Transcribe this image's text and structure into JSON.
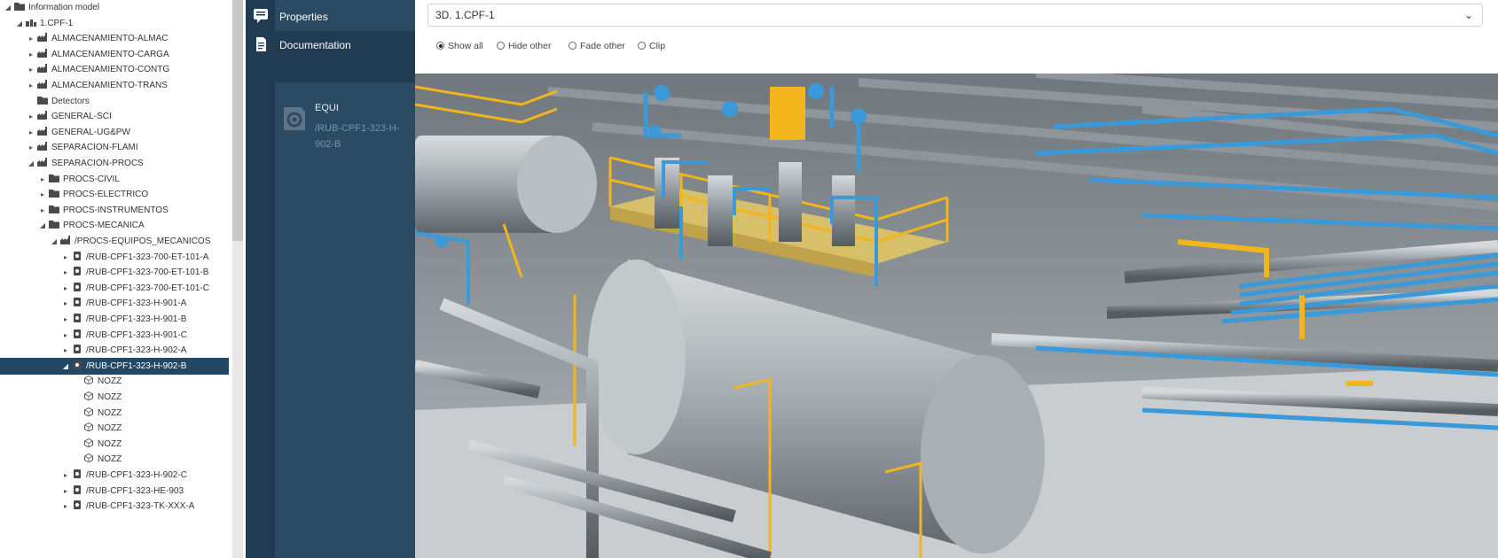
{
  "tree": {
    "items": [
      {
        "label": "Information model",
        "level": 0,
        "toggle": "◢",
        "icon": "folder-icon"
      },
      {
        "label": "1.CPF-1",
        "level": 1,
        "toggle": "◢",
        "icon": "site-icon"
      },
      {
        "label": "ALMACENAMIENTO-ALMAC",
        "level": 2,
        "toggle": "▸",
        "icon": "plant-icon"
      },
      {
        "label": "ALMACENAMIENTO-CARGA",
        "level": 2,
        "toggle": "▸",
        "icon": "plant-icon"
      },
      {
        "label": "ALMACENAMIENTO-CONTG",
        "level": 2,
        "toggle": "▸",
        "icon": "plant-icon"
      },
      {
        "label": "ALMACENAMIENTO-TRANS",
        "level": 2,
        "toggle": "▸",
        "icon": "plant-icon"
      },
      {
        "label": "Detectors",
        "level": 2,
        "toggle": "",
        "icon": "folder-icon"
      },
      {
        "label": "GENERAL-SCI",
        "level": 2,
        "toggle": "▸",
        "icon": "plant-icon"
      },
      {
        "label": "GENERAL-UG&PW",
        "level": 2,
        "toggle": "▸",
        "icon": "plant-icon"
      },
      {
        "label": "SEPARACION-FLAMI",
        "level": 2,
        "toggle": "▸",
        "icon": "plant-icon"
      },
      {
        "label": "SEPARACION-PROCS",
        "level": 2,
        "toggle": "◢",
        "icon": "plant-icon"
      },
      {
        "label": "PROCS-CIVIL",
        "level": 3,
        "toggle": "▸",
        "icon": "folder-icon"
      },
      {
        "label": "PROCS-ELECTRICO",
        "level": 3,
        "toggle": "▸",
        "icon": "folder-icon"
      },
      {
        "label": "PROCS-INSTRUMENTOS",
        "level": 3,
        "toggle": "▸",
        "icon": "folder-icon"
      },
      {
        "label": "PROCS-MECANICA",
        "level": 3,
        "toggle": "◢",
        "icon": "folder-icon"
      },
      {
        "label": "/PROCS-EQUIPOS_MECANICOS",
        "level": 4,
        "toggle": "◢",
        "icon": "plant-icon"
      },
      {
        "label": "/RUB-CPF1-323-700-ET-101-A",
        "level": 5,
        "toggle": "▸",
        "icon": "equipment-icon"
      },
      {
        "label": "/RUB-CPF1-323-700-ET-101-B",
        "level": 5,
        "toggle": "▸",
        "icon": "equipment-icon"
      },
      {
        "label": "/RUB-CPF1-323-700-ET-101-C",
        "level": 5,
        "toggle": "▸",
        "icon": "equipment-icon"
      },
      {
        "label": "/RUB-CPF1-323-H-901-A",
        "level": 5,
        "toggle": "▸",
        "icon": "equipment-icon"
      },
      {
        "label": "/RUB-CPF1-323-H-901-B",
        "level": 5,
        "toggle": "▸",
        "icon": "equipment-icon"
      },
      {
        "label": "/RUB-CPF1-323-H-901-C",
        "level": 5,
        "toggle": "▸",
        "icon": "equipment-icon"
      },
      {
        "label": "/RUB-CPF1-323-H-902-A",
        "level": 5,
        "toggle": "▸",
        "icon": "equipment-icon"
      },
      {
        "label": "/RUB-CPF1-323-H-902-B",
        "level": 5,
        "toggle": "◢",
        "icon": "equipment-icon",
        "selected": true
      },
      {
        "label": "NOZZ",
        "level": 6,
        "toggle": "",
        "icon": "nozzle-icon"
      },
      {
        "label": "NOZZ",
        "level": 6,
        "toggle": "",
        "icon": "nozzle-icon"
      },
      {
        "label": "NOZZ",
        "level": 6,
        "toggle": "",
        "icon": "nozzle-icon"
      },
      {
        "label": "NOZZ",
        "level": 6,
        "toggle": "",
        "icon": "nozzle-icon"
      },
      {
        "label": "NOZZ",
        "level": 6,
        "toggle": "",
        "icon": "nozzle-icon"
      },
      {
        "label": "NOZZ",
        "level": 6,
        "toggle": "",
        "icon": "nozzle-icon"
      },
      {
        "label": "/RUB-CPF1-323-H-902-C",
        "level": 5,
        "toggle": "▸",
        "icon": "equipment-icon"
      },
      {
        "label": "/RUB-CPF1-323-HE-903",
        "level": 5,
        "toggle": "▸",
        "icon": "equipment-icon"
      },
      {
        "label": "/RUB-CPF1-323-TK-XXX-A",
        "level": 5,
        "toggle": "▸",
        "icon": "equipment-icon"
      }
    ]
  },
  "sidenav": {
    "properties_label": "Properties",
    "documentation_label": "Documentation",
    "equipment": {
      "type_label": "EQUI",
      "name": "/RUB-CPF1-323-H-902-B"
    }
  },
  "viewer": {
    "model_select": "3D. 1.CPF-1",
    "modes": [
      {
        "label": "Show all",
        "checked": true
      },
      {
        "label": "Hide other",
        "checked": false
      },
      {
        "label": "Fade other",
        "checked": false
      },
      {
        "label": "Clip",
        "checked": false
      }
    ]
  },
  "colors": {
    "nav_bg": "#2b4a63",
    "selected_row": "#234866",
    "pipe_blue": "#3a9ad9",
    "railing_yellow": "#f2b51c",
    "steel_grey": "#9aa2a7"
  }
}
